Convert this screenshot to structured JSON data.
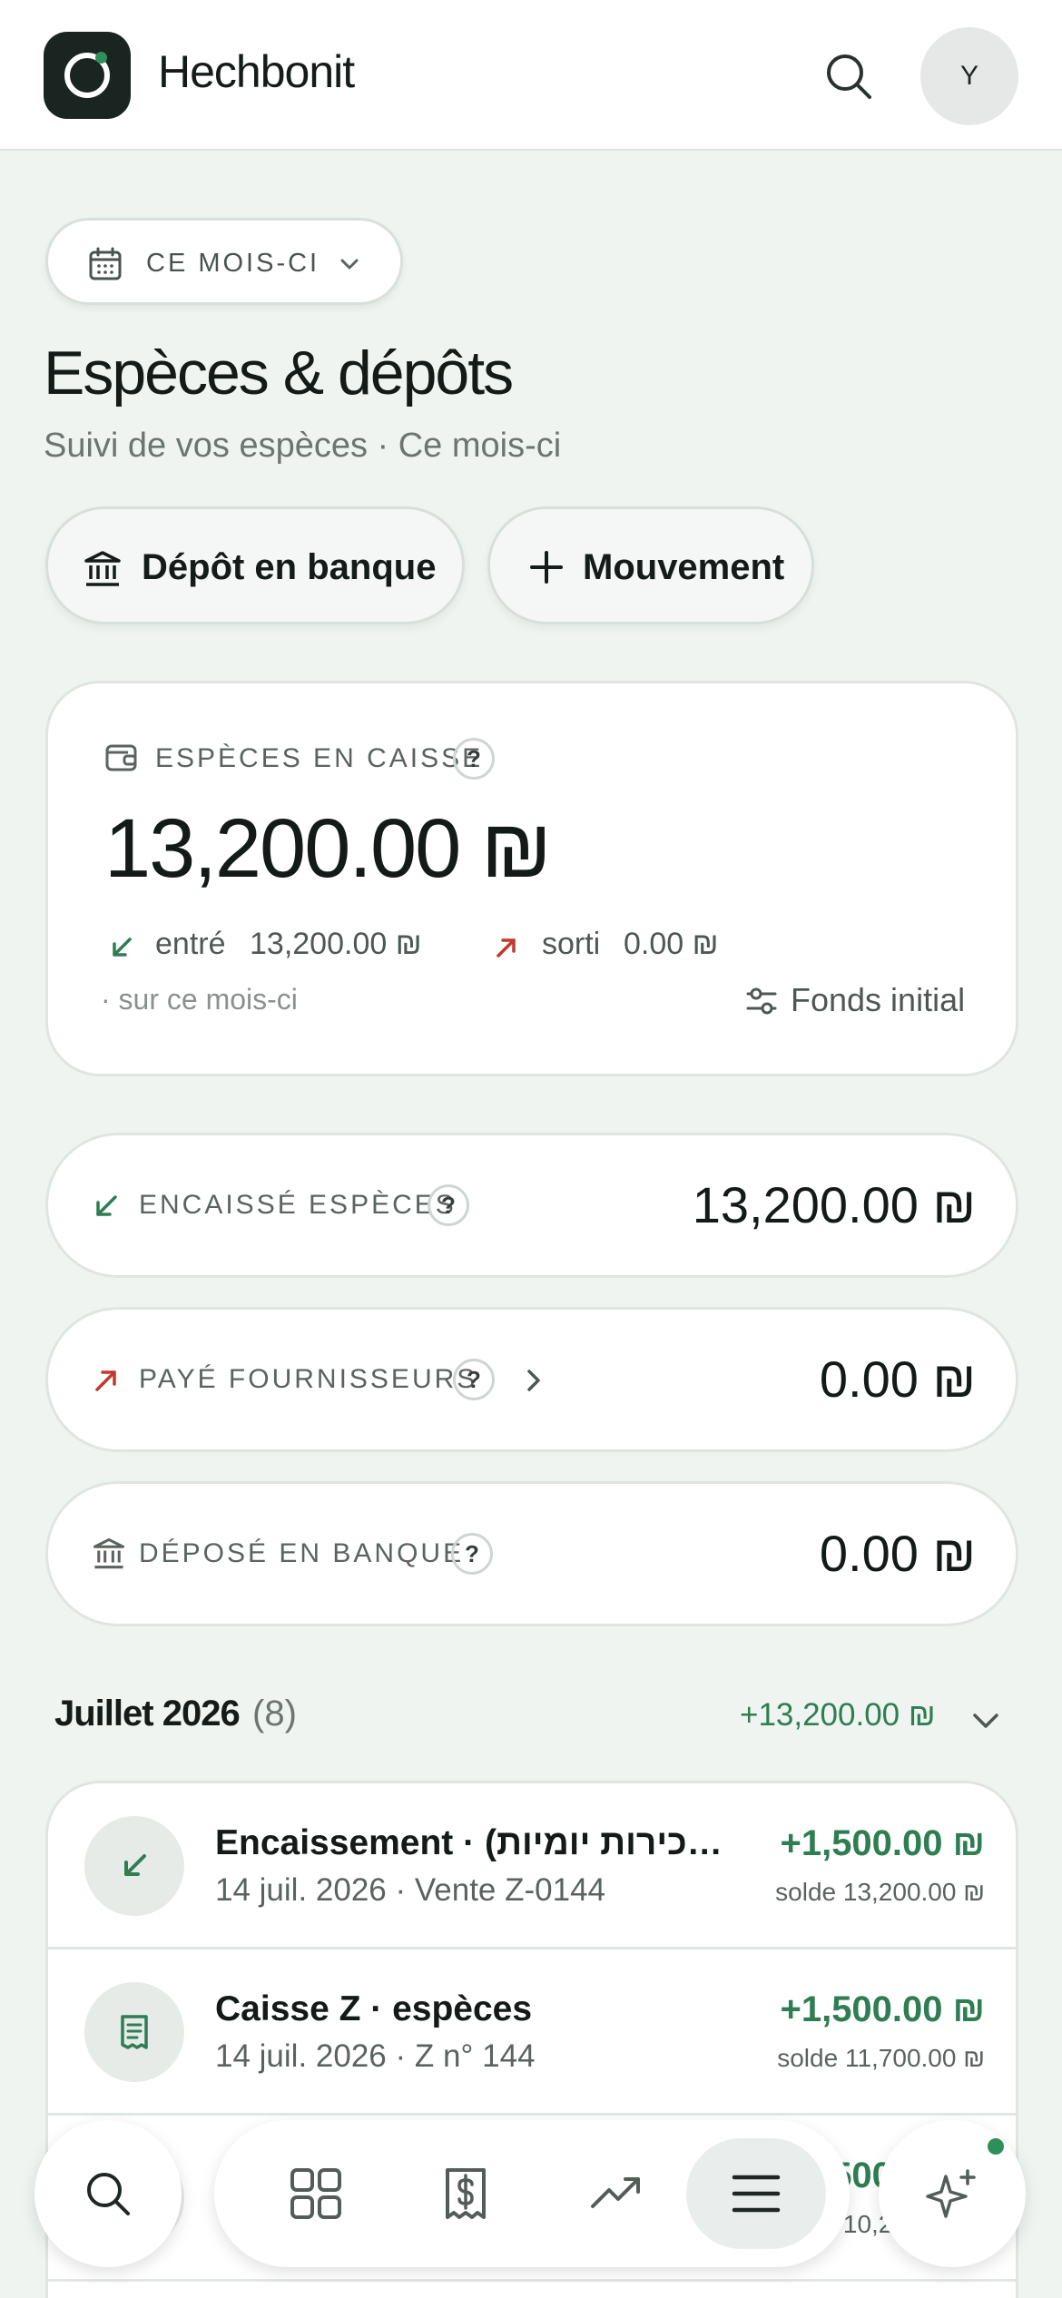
{
  "app": {
    "name": "Hechbonit",
    "avatar_initial": "Y"
  },
  "period": {
    "label": "CE MOIS-CI"
  },
  "page": {
    "title": "Espèces & dépôts",
    "subtitle": "Suivi de vos espèces · Ce mois-ci"
  },
  "actions": {
    "deposit": "Dépôt en banque",
    "movement": "Mouvement"
  },
  "cash": {
    "label": "ESPÈCES EN CAISSE",
    "help": "?",
    "amount": "13,200.00 ₪",
    "in_label": "entré",
    "in_value": "13,200.00 ₪",
    "out_label": "sorti",
    "out_value": "0.00 ₪",
    "scope": "· sur ce mois-ci",
    "fonds": "Fonds initial"
  },
  "stats": [
    {
      "label": "ENCAISSÉ ESPÈCES",
      "help": "?",
      "amount": "13,200.00 ₪"
    },
    {
      "label": "PAYÉ FOURNISSEURS",
      "help": "?",
      "amount": "0.00 ₪"
    },
    {
      "label": "DÉPOSÉ EN BANQUE",
      "help": "?",
      "amount": "0.00 ₪"
    }
  ],
  "month": {
    "title": "Juillet 2026",
    "count": "(8)",
    "total": "+13,200.00 ₪"
  },
  "transactions": [
    {
      "title": "Encaissement · (מכירות יומיות) ...",
      "meta": "14 juil. 2026 · Vente Z-0144",
      "amount": "+1,500.00 ₪",
      "balance": "solde 13,200.00 ₪",
      "icon": "arrow-down-left-icon"
    },
    {
      "title": "Caisse Z · espèces",
      "meta": "14 juil. 2026 · Z n° 144",
      "amount": "+1,500.00 ₪",
      "balance": "solde 11,700.00 ₪",
      "icon": "receipt-icon"
    },
    {
      "title": "",
      "meta": "",
      "amount": "+1,500.00 ₪",
      "balance": "solde 10,200.00 ₪",
      "icon": "arrow-down-left-icon"
    }
  ],
  "colors": {
    "accent_green": "#2f7d53",
    "out_red": "#c0392b",
    "background": "#eff4f1"
  },
  "nav": [
    "search-icon",
    "dashboard-icon",
    "receipt-dollar-icon",
    "trending-up-icon",
    "menu-icon",
    "sparkle-icon"
  ]
}
